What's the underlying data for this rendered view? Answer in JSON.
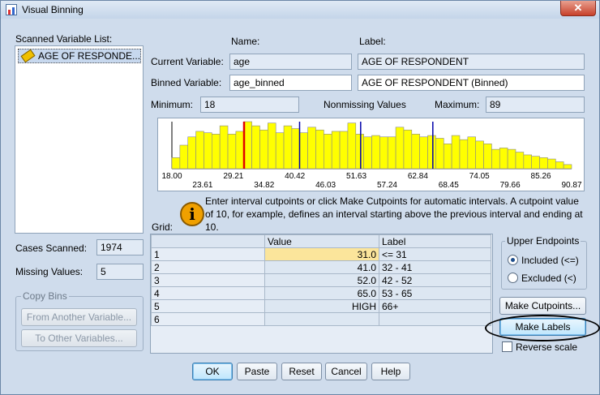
{
  "window": {
    "title": "Visual Binning",
    "close": "✕"
  },
  "scanned": {
    "label": "Scanned Variable List:",
    "items": [
      "AGE OF RESPONDE..."
    ]
  },
  "headers": {
    "name": "Name:",
    "label": "Label:"
  },
  "current": {
    "label": "Current Variable:",
    "name": "age",
    "var_label": "AGE OF RESPONDENT"
  },
  "binned": {
    "label": "Binned Variable:",
    "name": "age_binned",
    "var_label": "AGE OF RESPONDENT (Binned)"
  },
  "stats": {
    "min_label": "Minimum:",
    "min": "18",
    "nonmissing_label": "Nonmissing Values",
    "max_label": "Maximum:",
    "max": "89"
  },
  "chart_data": {
    "type": "bar",
    "values": [
      8,
      17,
      23,
      27,
      26,
      25,
      31,
      25,
      27,
      34,
      31,
      28,
      33,
      26,
      31,
      29,
      26,
      30,
      28,
      25,
      27,
      27,
      33,
      25,
      23,
      24,
      23,
      23,
      30,
      28,
      25,
      23,
      24,
      22,
      18,
      24,
      21,
      23,
      20,
      18,
      14,
      15,
      14,
      12,
      10,
      9,
      8,
      7,
      5,
      3
    ],
    "tick_labels_top": [
      "18.00",
      "29.21",
      "40.42",
      "51.63",
      "62.84",
      "74.05",
      "85.26"
    ],
    "tick_labels_bottom": [
      "23.61",
      "34.82",
      "46.03",
      "57.24",
      "68.45",
      "79.66",
      "90.87"
    ],
    "cutpoints": [
      31,
      41,
      52,
      65
    ],
    "x_range": [
      18,
      90
    ],
    "highlight_cutpoint": 31,
    "colors": {
      "bar": "#ffff00",
      "cut": "#0000aa",
      "selected_cut": "#e00000"
    }
  },
  "info": {
    "icon": "info-icon",
    "text": "Enter interval cutpoints or click Make Cutpoints for automatic intervals. A cutpoint value of 10, for example, defines an interval starting above the previous interval and ending at 10."
  },
  "grid": {
    "label": "Grid:",
    "headers": [
      "Value",
      "Label"
    ],
    "rows": [
      {
        "num": "1",
        "value": "31.0",
        "label": "<= 31"
      },
      {
        "num": "2",
        "value": "41.0",
        "label": "32 - 41"
      },
      {
        "num": "3",
        "value": "52.0",
        "label": "42 - 52"
      },
      {
        "num": "4",
        "value": "65.0",
        "label": "53 - 65"
      },
      {
        "num": "5",
        "value": "HIGH",
        "label": "66+"
      },
      {
        "num": "6",
        "value": "",
        "label": ""
      }
    ]
  },
  "cases": {
    "scanned_label": "Cases Scanned:",
    "scanned": "1974",
    "missing_label": "Missing Values:",
    "missing": "5"
  },
  "copy_bins": {
    "title": "Copy Bins",
    "from": "From Another Variable...",
    "to": "To Other Variables..."
  },
  "upper": {
    "title": "Upper Endpoints",
    "included": "Included (<=)",
    "excluded": "Excluded (<)"
  },
  "buttons": {
    "make_cutpoints": "Make Cutpoints...",
    "make_labels": "Make Labels",
    "reverse": "Reverse scale",
    "ok": "OK",
    "paste": "Paste",
    "reset": "Reset",
    "cancel": "Cancel",
    "help": "Help"
  }
}
